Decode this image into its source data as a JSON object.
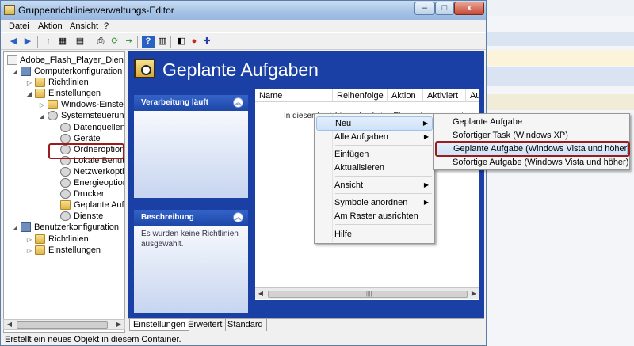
{
  "window": {
    "title": "Gruppenrichtlinienverwaltungs-Editor",
    "minimize": "–",
    "maximize": "□",
    "close": "x"
  },
  "menubar": [
    "Datei",
    "Aktion",
    "Ansicht",
    "?"
  ],
  "toolbar": {
    "back": "◀",
    "forward": "▶",
    "up": "↑",
    "view": "▦",
    "properties": "▤",
    "print": "⎙",
    "refresh": "⟳",
    "export": "⇥",
    "help": "?",
    "details": "▥",
    "new_task": "◧",
    "stop": "●",
    "add": "✚"
  },
  "tree": {
    "root": "Adobe_Flash_Player_Dienst_Geplante",
    "items": [
      {
        "label": "Computerkonfiguration",
        "exp": "◢",
        "icon": "comp"
      },
      {
        "label": "Richtlinien",
        "exp": "▷",
        "icon": "folder"
      },
      {
        "label": "Einstellungen",
        "exp": "◢",
        "icon": "folder"
      },
      {
        "label": "Windows-Einstellungen",
        "exp": "▷",
        "icon": "folder"
      },
      {
        "label": "Systemsteuerungseinstellungen",
        "exp": "◢",
        "icon": "gear"
      },
      {
        "label": "Datenquellen",
        "exp": "",
        "icon": "gear"
      },
      {
        "label": "Geräte",
        "exp": "",
        "icon": "gear"
      },
      {
        "label": "Ordneroptionen",
        "exp": "",
        "icon": "gear"
      },
      {
        "label": "Lokale Benutzer und Gruppen",
        "exp": "",
        "icon": "gear"
      },
      {
        "label": "Netzwerkoptionen",
        "exp": "",
        "icon": "gear"
      },
      {
        "label": "Energieoptionen",
        "exp": "",
        "icon": "gear"
      },
      {
        "label": "Drucker",
        "exp": "",
        "icon": "gear"
      },
      {
        "label": "Geplante Aufgaben",
        "exp": "",
        "icon": "folder"
      },
      {
        "label": "Dienste",
        "exp": "",
        "icon": "gear"
      },
      {
        "label": "Benutzerkonfiguration",
        "exp": "◢",
        "icon": "comp"
      },
      {
        "label": "Richtlinien",
        "exp": "▷",
        "icon": "folder"
      },
      {
        "label": "Einstellungen",
        "exp": "▷",
        "icon": "folder"
      }
    ],
    "scroll_left": "◀",
    "scroll_right": "▶"
  },
  "content": {
    "title": "Geplante Aufgaben",
    "panel_processing": {
      "title": "Verarbeitung läuft",
      "collapse": "︽"
    },
    "panel_description": {
      "title": "Beschreibung",
      "collapse": "︽",
      "text": "Es wurden keine Richtlinien ausgewählt."
    },
    "columns": [
      "Name",
      "Reihenfolge",
      "Aktion",
      "Aktiviert",
      "Au"
    ],
    "empty_text": "In dieser Ansicht werden keine Elemente angezeigt.",
    "scroll_left": "◀",
    "scroll_right": "▶",
    "scroll_grip": "||||"
  },
  "tabs": [
    "Einstellungen",
    "Erweitert",
    "Standard"
  ],
  "status": "Erstellt ein neues Objekt in diesem Container.",
  "context_menu": {
    "items": [
      "Neu",
      "Alle Aufgaben",
      "Einfügen",
      "Aktualisieren",
      "Ansicht",
      "Symbole anordnen",
      "Am Raster ausrichten",
      "Hilfe"
    ],
    "arrow": "▶"
  },
  "submenu": {
    "items": [
      "Geplante Aufgabe",
      "Sofortiger Task (Windows XP)",
      "Geplante Aufgabe (Windows Vista und höher)",
      "Sofortige Aufgabe (Windows Vista und höher)"
    ]
  },
  "colors": {
    "content_bg": "#1a3fa5",
    "highlight_border": "#9c1c1c",
    "menu_hover": "#cfe2f8"
  }
}
